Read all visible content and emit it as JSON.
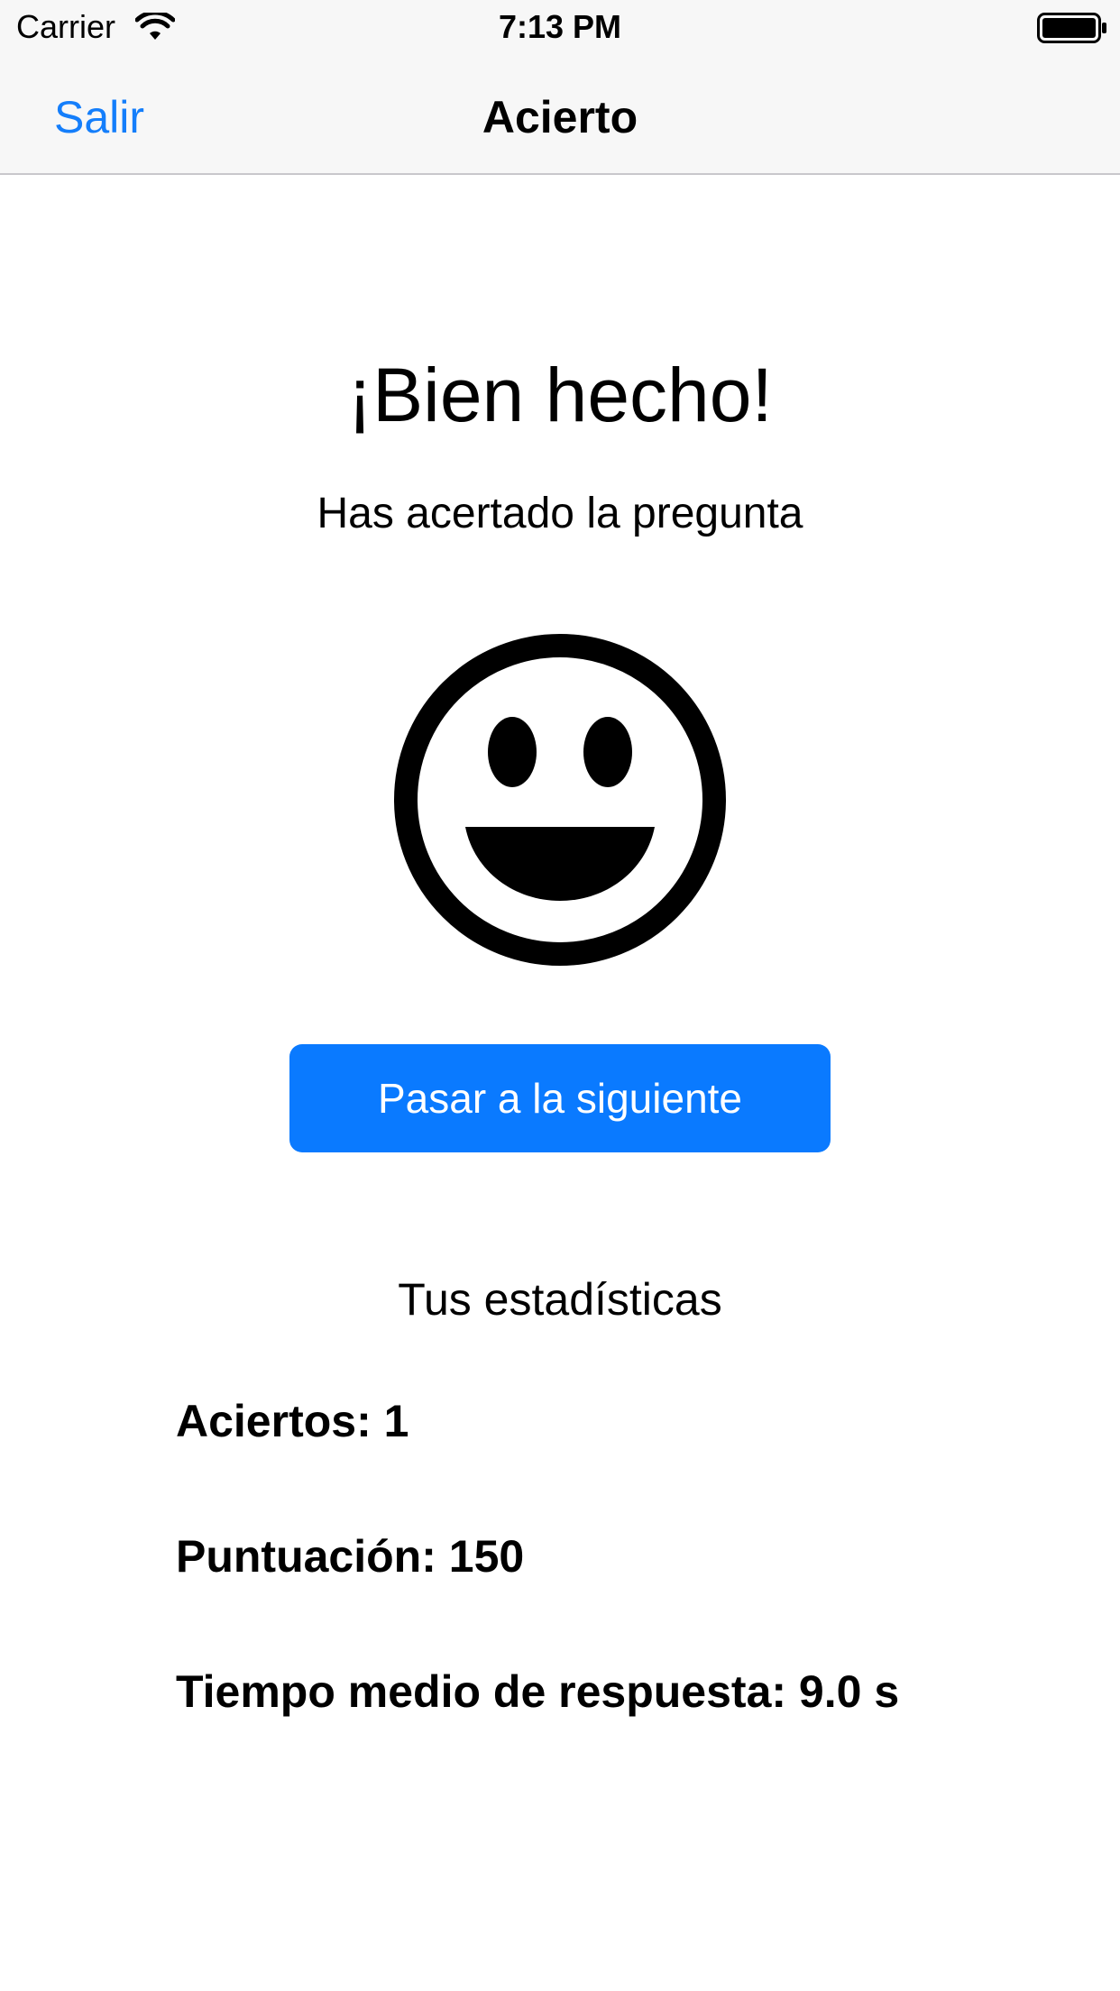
{
  "status_bar": {
    "carrier": "Carrier",
    "time": "7:13 PM",
    "icons": [
      "wifi-icon",
      "battery-icon"
    ]
  },
  "nav": {
    "back_label": "Salir",
    "title": "Acierto",
    "accent_color": "#147efb"
  },
  "result": {
    "headline": "¡Bien hecho!",
    "subtitle": "Has acertado la pregunta",
    "icon": "smiley-face-icon"
  },
  "next_button": {
    "label": "Pasar a la siguiente",
    "color": "#0a7aff"
  },
  "stats": {
    "title": "Tus estadísticas",
    "aciertos": "Aciertos: 1",
    "puntuacion": "Puntuación: 150",
    "tiempo": "Tiempo medio de respuesta: 9.0 s"
  }
}
